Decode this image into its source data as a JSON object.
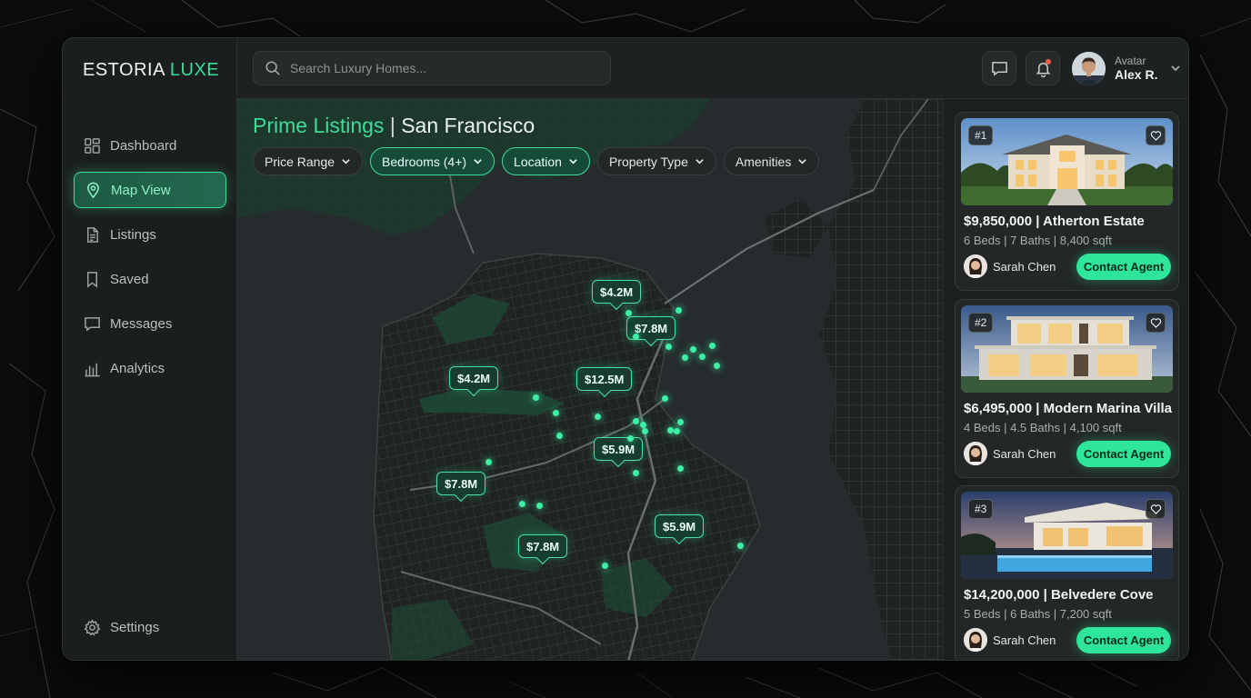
{
  "app": {
    "logo_main": "ESTORIA",
    "logo_accent": "LUXE"
  },
  "sidebar": {
    "items": [
      {
        "label": "Dashboard",
        "icon": "grid-icon",
        "active": false
      },
      {
        "label": "Map View",
        "icon": "map-pin-icon",
        "active": true
      },
      {
        "label": "Listings",
        "icon": "document-icon",
        "active": false
      },
      {
        "label": "Saved",
        "icon": "bookmark-icon",
        "active": false
      },
      {
        "label": "Messages",
        "icon": "chat-icon",
        "active": false
      },
      {
        "label": "Analytics",
        "icon": "bar-chart-icon",
        "active": false
      }
    ],
    "settings_label": "Settings"
  },
  "header": {
    "search_placeholder": "Search Luxury Homes...",
    "user_role": "Avatar",
    "user_name": "Alex R."
  },
  "map": {
    "title_main": "Prime Listings",
    "title_separator": "|",
    "title_city": "San Francisco",
    "filters": [
      {
        "label": "Price Range",
        "active": false
      },
      {
        "label": "Bedrooms (4+)",
        "active": true
      },
      {
        "label": "Location",
        "active": true
      },
      {
        "label": "Property Type",
        "active": false
      },
      {
        "label": "Amenities",
        "active": false
      }
    ],
    "pins": [
      "$4.2M",
      "$7.8M",
      "$4.2M",
      "$12.5M",
      "$5.9M",
      "$7.8M",
      "$5.9M",
      "$7.8M"
    ]
  },
  "listings": [
    {
      "rank": "#1",
      "title": "$9,850,000 | Atherton Estate",
      "specs": "6 Beds | 7 Baths | 8,400 sqft",
      "agent": "Sarah Chen",
      "cta": "Contact Agent"
    },
    {
      "rank": "#2",
      "title": "$6,495,000 | Modern Marina Villa",
      "specs": "4 Beds | 4.5 Baths | 4,100 sqft",
      "agent": "Sarah Chen",
      "cta": "Contact Agent"
    },
    {
      "rank": "#3",
      "title": "$14,200,000 | Belvedere Cove",
      "specs": "5 Beds | 6 Baths | 7,200 sqft",
      "agent": "Sarah Chen",
      "cta": "Contact Agent"
    }
  ],
  "colors": {
    "accent": "#3ddc97",
    "pin_dot": "#3ef0a6",
    "background": "#1c1f1f"
  }
}
